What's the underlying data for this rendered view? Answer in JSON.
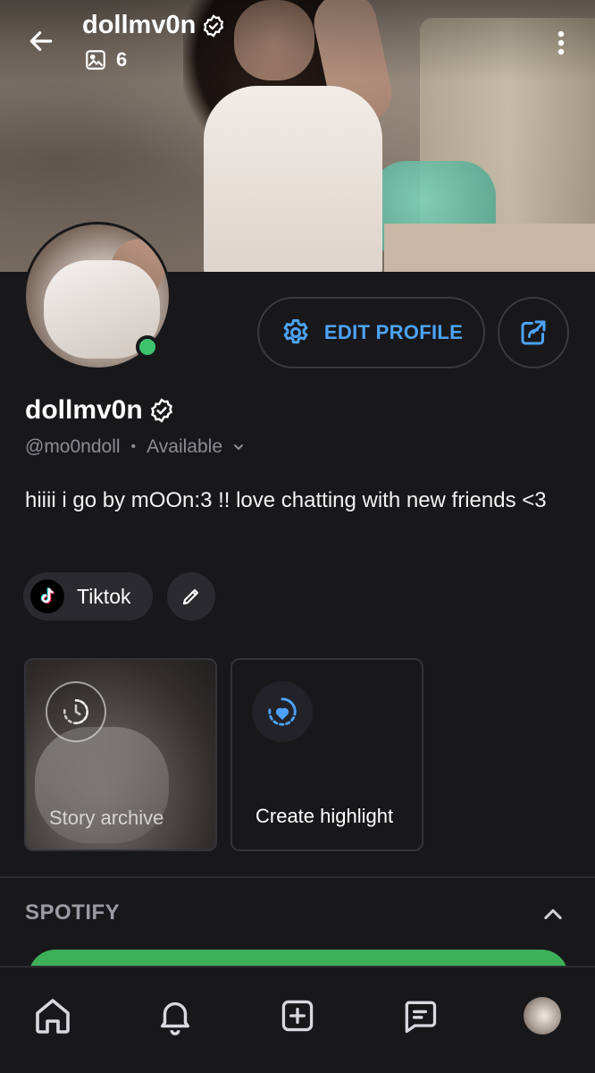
{
  "header": {
    "title": "dollmv0n",
    "media_count": "6"
  },
  "profile": {
    "display_name": "dollmv0n",
    "handle": "@mo0ndoll",
    "status": "Available",
    "bio": "hiiii i go by mOOn:3 !! love chatting with new friends <3",
    "online": true
  },
  "actions": {
    "edit_profile_label": "EDIT PROFILE"
  },
  "links": [
    {
      "label": "Tiktok",
      "icon": "tiktok-icon"
    }
  ],
  "highlights": {
    "archive_label": "Story archive",
    "create_label": "Create highlight"
  },
  "spotify": {
    "section_title": "SPOTIFY"
  },
  "nav": {
    "items": [
      "home-icon",
      "bell-icon",
      "plus-square-icon",
      "chat-icon",
      "profile-avatar"
    ]
  },
  "colors": {
    "accent": "#4da3f7",
    "online": "#3ec46d",
    "spotify": "#3eb05a",
    "background": "#18181b"
  }
}
